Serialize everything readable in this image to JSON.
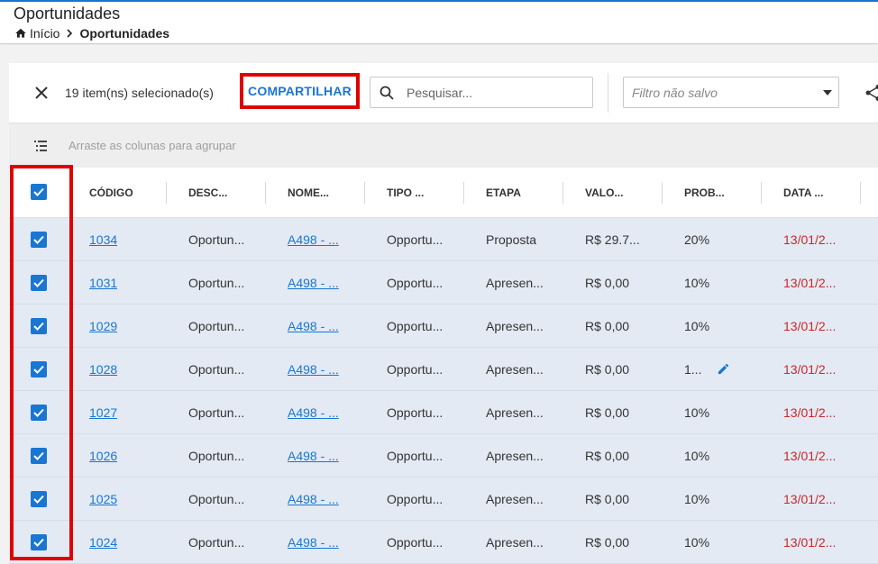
{
  "header": {
    "title": "Oportunidades",
    "breadcrumb_home": "Início",
    "breadcrumb_current": "Oportunidades"
  },
  "toolbar": {
    "selected_count": "19 item(ns) selecionado(s)",
    "share_label": "COMPARTILHAR",
    "search_placeholder": "Pesquisar...",
    "filter_placeholder": "Filtro não salvo"
  },
  "groupbar": {
    "text": "Arraste as colunas para agrupar"
  },
  "grid": {
    "columns": [
      "CÓDIGO",
      "DESC...",
      "NOME...",
      "TIPO ...",
      "ETAPA",
      "VALO...",
      "PROB...",
      "DATA ..."
    ],
    "rows": [
      {
        "codigo": "1034",
        "desc": "Oportun...",
        "nome": "A498 - ...",
        "tipo": "Opportu...",
        "etapa": "Proposta",
        "valor": "R$ 29.7...",
        "prob": "20%",
        "data": "13/01/2..."
      },
      {
        "codigo": "1031",
        "desc": "Oportun...",
        "nome": "A498 - ...",
        "tipo": "Opportu...",
        "etapa": "Apresen...",
        "valor": "R$ 0,00",
        "prob": "10%",
        "data": "13/01/2..."
      },
      {
        "codigo": "1029",
        "desc": "Oportun...",
        "nome": "A498 - ...",
        "tipo": "Opportu...",
        "etapa": "Apresen...",
        "valor": "R$ 0,00",
        "prob": "10%",
        "data": "13/01/2..."
      },
      {
        "codigo": "1028",
        "desc": "Oportun...",
        "nome": "A498 - ...",
        "tipo": "Opportu...",
        "etapa": "Apresen...",
        "valor": "R$ 0,00",
        "prob": "1...",
        "data": "13/01/2..."
      },
      {
        "codigo": "1027",
        "desc": "Oportun...",
        "nome": "A498 - ...",
        "tipo": "Opportu...",
        "etapa": "Apresen...",
        "valor": "R$ 0,00",
        "prob": "10%",
        "data": "13/01/2..."
      },
      {
        "codigo": "1026",
        "desc": "Oportun...",
        "nome": "A498 - ...",
        "tipo": "Opportu...",
        "etapa": "Apresen...",
        "valor": "R$ 0,00",
        "prob": "10%",
        "data": "13/01/2..."
      },
      {
        "codigo": "1025",
        "desc": "Oportun...",
        "nome": "A498 - ...",
        "tipo": "Opportu...",
        "etapa": "Apresen...",
        "valor": "R$ 0,00",
        "prob": "10%",
        "data": "13/01/2..."
      },
      {
        "codigo": "1024",
        "desc": "Oportun...",
        "nome": "A498 - ...",
        "tipo": "Opportu...",
        "etapa": "Apresen...",
        "valor": "R$ 0,00",
        "prob": "10%",
        "data": "13/01/2..."
      }
    ]
  },
  "colors": {
    "accent": "#1976d2",
    "highlight": "#e00000",
    "row_selected": "#e3eaf4",
    "date_red": "#c62828"
  }
}
